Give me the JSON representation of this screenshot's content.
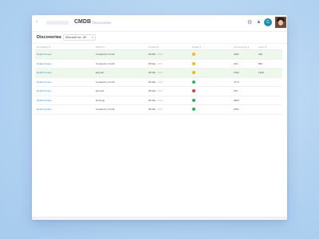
{
  "topbar": {
    "back_icon": "chevron-left-icon",
    "app_title": "CMDB",
    "crumb_sep": "›",
    "crumb_item": "Discoveries",
    "settings_icon": "gear-icon",
    "notifications_icon": "bell-icon",
    "avatar_initial": "C"
  },
  "toolbar": {
    "title": "Discoveries",
    "title_caret": "▾",
    "filter_value": "Microsoft inc. UK",
    "filter_caret": "▾"
  },
  "table": {
    "headers": [
      "Description ▾",
      "Status ▾",
      "Created ▾",
      "Health ▾",
      "Occurrences ▾",
      "Score ▾"
    ],
    "rows": [
      {
        "desc": "Default Scope",
        "status": "Created by Cmdb",
        "date": "09 Mar",
        "date_sub": "2023",
        "health": "warn",
        "occ": "2201",
        "score": "426",
        "hl": true
      },
      {
        "desc": "Default Scope",
        "status": "Created by Cmdb",
        "date": "09 Mar",
        "date_sub": "2023",
        "health": "warn",
        "occ": "234",
        "score": "896",
        "hl": false
      },
      {
        "desc": "Default Scope",
        "status": "Expired",
        "date": "09 Mar",
        "date_sub": "2023",
        "health": "warn",
        "occ": "1402",
        "score": "1498",
        "hl": true
      },
      {
        "desc": "Default Scope",
        "status": "Created by Cmdb",
        "date": "09 Mar",
        "date_sub": "2023",
        "health": "ok",
        "occ": "4773",
        "score": "",
        "hl": false
      },
      {
        "desc": "Default Scope",
        "status": "Expired",
        "date": "09 Mar",
        "date_sub": "2023",
        "health": "err",
        "occ": "234",
        "score": "",
        "hl": false
      },
      {
        "desc": "Default Scope",
        "status": "Running",
        "date": "09 Mar",
        "date_sub": "2023",
        "health": "ok",
        "occ": "9903",
        "score": "",
        "hl": false
      },
      {
        "desc": "Default Scope",
        "status": "Created by Cmdb",
        "date": "09 Mar",
        "date_sub": "2023",
        "health": "ok",
        "occ": "2201",
        "score": "",
        "hl": false
      }
    ]
  },
  "colors": {
    "link": "#3d8fd9",
    "health_warn": "#f2b51e",
    "health_ok": "#2fb35a",
    "health_err": "#e0364b",
    "row_highlight": "#edf7ea"
  }
}
